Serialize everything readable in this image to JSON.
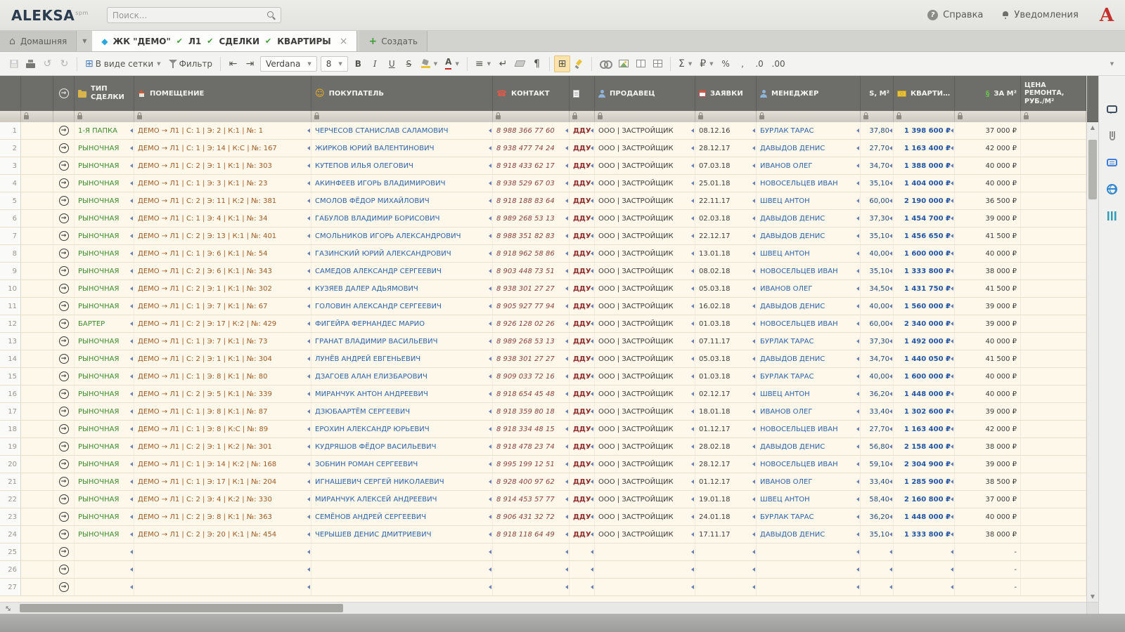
{
  "colors": {
    "accent_green": "#3f9c35",
    "type_green": "#3f8a2e",
    "room_brown": "#9e5a24",
    "link_blue": "#2f62a8",
    "price_blue": "#2456a4",
    "contact_red": "#8a4040",
    "brand_red": "#c4302b",
    "header_gray": "#6d6d69",
    "row_cream": "#fdf8ea"
  },
  "topbar": {
    "logo": "ALEKSA",
    "logo_sup": "spm",
    "search_placeholder": "Поиск...",
    "help": "Справка",
    "notifications": "Уведомления",
    "brand_letter": "A"
  },
  "tabs": {
    "home": "Домашняя",
    "active_parts": [
      "ЖК \"ДЕМО\"",
      "Л1",
      "СДЕЛКИ",
      "КВАРТИРЫ"
    ],
    "create": "Создать"
  },
  "toolbar": {
    "view_mode": "В виде сетки",
    "filter": "Фильтр",
    "font": "Verdana",
    "size": "8",
    "bold": "B",
    "italic": "I",
    "underline": "U",
    "strike": "S",
    "text_color": "А",
    "sum": "Σ",
    "ruble": "₽",
    "percent": "%",
    "comma": ",",
    "dec0": ".0",
    "dec00": ".00"
  },
  "right_rail": {
    "icons": [
      "comments-icon",
      "attachment-icon",
      "notes-icon",
      "web-icon",
      "analytics-icon"
    ]
  },
  "grid": {
    "columns": [
      {
        "key": "rownum",
        "label": ""
      },
      {
        "key": "spacer",
        "label": ""
      },
      {
        "key": "arrow",
        "label": "",
        "icon": "arrow-circle-icon"
      },
      {
        "key": "type",
        "label": "ТИП СДЕЛКИ",
        "icon": "folder-icon"
      },
      {
        "key": "room",
        "label": "ПОМЕЩЕНИЕ",
        "icon": "house-icon"
      },
      {
        "key": "buyer",
        "label": "ПОКУПАТЕЛЬ",
        "icon": "smiley-icon"
      },
      {
        "key": "contact",
        "label": "КОНТАКТ",
        "icon": "phone-icon"
      },
      {
        "key": "doc",
        "label": "",
        "icon": "document-icon"
      },
      {
        "key": "seller",
        "label": "ПРОДАВЕЦ",
        "icon": "person-icon"
      },
      {
        "key": "date",
        "label": "ЗАЯВКИ",
        "icon": "calendar-icon"
      },
      {
        "key": "manager",
        "label": "МЕНЕДЖЕР",
        "icon": "person-icon"
      },
      {
        "key": "s",
        "label": "S, М²"
      },
      {
        "key": "price",
        "label": "КВАРТИРЫ",
        "icon": "banknote-icon"
      },
      {
        "key": "price_m2",
        "label": "ЗА М²",
        "icon": "section-icon"
      },
      {
        "key": "repair",
        "label": "ЦЕНА РЕМОНТА, РУБ./М²"
      }
    ],
    "rows": [
      {
        "num": 1,
        "type": "1-Я ПАПКА",
        "room": "ДЕМО → Л1 | С: 1 | Э: 2 | К:1 | №: 1",
        "buyer": "ЧЕРЧЕСОВ СТАНИСЛАВ САЛАМОВИЧ",
        "contact": "8 988 366 77 60",
        "doc": "ДДУ",
        "seller": "ООО | ЗАСТРОЙЩИК",
        "date": "08.12.16",
        "manager": "БУРЛАК ТАРАС",
        "s": "37,80",
        "price": "1 398 600 ₽",
        "price_m2": "37 000 ₽",
        "repair": ""
      },
      {
        "num": 2,
        "type": "РЫНОЧНАЯ",
        "room": "ДЕМО → Л1 | С: 1 | Э: 14 | К:С | №: 167",
        "buyer": "ЖИРКОВ ЮРИЙ ВАЛЕНТИНОВИЧ",
        "contact": "8 938 477 74 24",
        "doc": "ДДУ",
        "seller": "ООО | ЗАСТРОЙЩИК",
        "date": "28.12.17",
        "manager": "ДАВЫДОВ ДЕНИС",
        "s": "27,70",
        "price": "1 163 400 ₽",
        "price_m2": "42 000 ₽",
        "repair": ""
      },
      {
        "num": 3,
        "type": "РЫНОЧНАЯ",
        "room": "ДЕМО → Л1 | С: 2 | Э: 1 | К:1 | №: 303",
        "buyer": "КУТЕПОВ ИЛЬЯ ОЛЕГОВИЧ",
        "contact": "8 918 433 62 17",
        "doc": "ДДУ",
        "seller": "ООО | ЗАСТРОЙЩИК",
        "date": "07.03.18",
        "manager": "ИВАНОВ ОЛЕГ",
        "s": "34,70",
        "price": "1 388 000 ₽",
        "price_m2": "40 000 ₽",
        "repair": ""
      },
      {
        "num": 4,
        "type": "РЫНОЧНАЯ",
        "room": "ДЕМО → Л1 | С: 1 | Э: 3 | К:1 | №: 23",
        "buyer": "АКИНФЕЕВ ИГОРЬ ВЛАДИМИРОВИЧ",
        "contact": "8 938 529 67 03",
        "doc": "ДДУ",
        "seller": "ООО | ЗАСТРОЙЩИК",
        "date": "25.01.18",
        "manager": "НОВОСЕЛЬЦЕВ ИВАН",
        "s": "35,10",
        "price": "1 404 000 ₽",
        "price_m2": "40 000 ₽",
        "repair": ""
      },
      {
        "num": 5,
        "type": "РЫНОЧНАЯ",
        "room": "ДЕМО → Л1 | С: 2 | Э: 11 | К:2 | №: 381",
        "buyer": "СМОЛОВ ФЁДОР МИХАЙЛОВИЧ",
        "contact": "8 918 188 83 64",
        "doc": "ДДУ",
        "seller": "ООО | ЗАСТРОЙЩИК",
        "date": "22.11.17",
        "manager": "ШВЕЦ АНТОН",
        "s": "60,00",
        "price": "2 190 000 ₽",
        "price_m2": "36 500 ₽",
        "repair": ""
      },
      {
        "num": 6,
        "type": "РЫНОЧНАЯ",
        "room": "ДЕМО → Л1 | С: 1 | Э: 4 | К:1 | №: 34",
        "buyer": "ГАБУЛОВ ВЛАДИМИР БОРИСОВИЧ",
        "contact": "8 989 268 53 13",
        "doc": "ДДУ",
        "seller": "ООО | ЗАСТРОЙЩИК",
        "date": "02.03.18",
        "manager": "ДАВЫДОВ ДЕНИС",
        "s": "37,30",
        "price": "1 454 700 ₽",
        "price_m2": "39 000 ₽",
        "repair": ""
      },
      {
        "num": 7,
        "type": "РЫНОЧНАЯ",
        "room": "ДЕМО → Л1 | С: 2 | Э: 13 | К:1 | №: 401",
        "buyer": "СМОЛЬНИКОВ ИГОРЬ АЛЕКСАНДРОВИЧ",
        "contact": "8 988 351 82 83",
        "doc": "ДДУ",
        "seller": "ООО | ЗАСТРОЙЩИК",
        "date": "22.12.17",
        "manager": "ДАВЫДОВ ДЕНИС",
        "s": "35,10",
        "price": "1 456 650 ₽",
        "price_m2": "41 500 ₽",
        "repair": ""
      },
      {
        "num": 8,
        "type": "РЫНОЧНАЯ",
        "room": "ДЕМО → Л1 | С: 1 | Э: 6 | К:1 | №: 54",
        "buyer": "ГАЗИНСКИЙ ЮРИЙ АЛЕКСАНДРОВИЧ",
        "contact": "8 918 962 58 86",
        "doc": "ДДУ",
        "seller": "ООО | ЗАСТРОЙЩИК",
        "date": "13.01.18",
        "manager": "ШВЕЦ АНТОН",
        "s": "40,00",
        "price": "1 600 000 ₽",
        "price_m2": "40 000 ₽",
        "repair": ""
      },
      {
        "num": 9,
        "type": "РЫНОЧНАЯ",
        "room": "ДЕМО → Л1 | С: 2 | Э: 6 | К:1 | №: 343",
        "buyer": "САМЕДОВ АЛЕКСАНДР СЕРГЕЕВИЧ",
        "contact": "8 903 448 73 51",
        "doc": "ДДУ",
        "seller": "ООО | ЗАСТРОЙЩИК",
        "date": "08.02.18",
        "manager": "НОВОСЕЛЬЦЕВ ИВАН",
        "s": "35,10",
        "price": "1 333 800 ₽",
        "price_m2": "38 000 ₽",
        "repair": ""
      },
      {
        "num": 10,
        "type": "РЫНОЧНАЯ",
        "room": "ДЕМО → Л1 | С: 2 | Э: 1 | К:1 | №: 302",
        "buyer": "КУЗЯЕВ ДАЛЕР АДЬЯМОВИЧ",
        "contact": "8 938 301 27 27",
        "doc": "ДДУ",
        "seller": "ООО | ЗАСТРОЙЩИК",
        "date": "05.03.18",
        "manager": "ИВАНОВ ОЛЕГ",
        "s": "34,50",
        "price": "1 431 750 ₽",
        "price_m2": "41 500 ₽",
        "repair": ""
      },
      {
        "num": 11,
        "type": "РЫНОЧНАЯ",
        "room": "ДЕМО → Л1 | С: 1 | Э: 7 | К:1 | №: 67",
        "buyer": "ГОЛОВИН АЛЕКСАНДР СЕРГЕЕВИЧ",
        "contact": "8 905 927 77 94",
        "doc": "ДДУ",
        "seller": "ООО | ЗАСТРОЙЩИК",
        "date": "16.02.18",
        "manager": "ДАВЫДОВ ДЕНИС",
        "s": "40,00",
        "price": "1 560 000 ₽",
        "price_m2": "39 000 ₽",
        "repair": ""
      },
      {
        "num": 12,
        "type": "БАРТЕР",
        "room": "ДЕМО → Л1 | С: 2 | Э: 17 | К:2 | №: 429",
        "buyer": "ФИГЕЙРА ФЕРНАНДЕС МАРИО",
        "contact": "8 926 128 02 26",
        "doc": "ДДУ",
        "seller": "ООО | ЗАСТРОЙЩИК",
        "date": "01.03.18",
        "manager": "НОВОСЕЛЬЦЕВ ИВАН",
        "s": "60,00",
        "price": "2 340 000 ₽",
        "price_m2": "39 000 ₽",
        "repair": ""
      },
      {
        "num": 13,
        "type": "РЫНОЧНАЯ",
        "room": "ДЕМО → Л1 | С: 1 | Э: 7 | К:1 | №: 73",
        "buyer": "ГРАНАТ ВЛАДИМИР ВАСИЛЬЕВИЧ",
        "contact": "8 989 268 53 13",
        "doc": "ДДУ",
        "seller": "ООО | ЗАСТРОЙЩИК",
        "date": "07.11.17",
        "manager": "БУРЛАК ТАРАС",
        "s": "37,30",
        "price": "1 492 000 ₽",
        "price_m2": "40 000 ₽",
        "repair": ""
      },
      {
        "num": 14,
        "type": "РЫНОЧНАЯ",
        "room": "ДЕМО → Л1 | С: 2 | Э: 1 | К:1 | №: 304",
        "buyer": "ЛУНЁВ АНДРЕЙ ЕВГЕНЬЕВИЧ",
        "contact": "8 938 301 27 27",
        "doc": "ДДУ",
        "seller": "ООО | ЗАСТРОЙЩИК",
        "date": "05.03.18",
        "manager": "ДАВЫДОВ ДЕНИС",
        "s": "34,70",
        "price": "1 440 050 ₽",
        "price_m2": "41 500 ₽",
        "repair": ""
      },
      {
        "num": 15,
        "type": "РЫНОЧНАЯ",
        "room": "ДЕМО → Л1 | С: 1 | Э: 8 | К:1 | №: 80",
        "buyer": "ДЗАГОЕВ АЛАН ЕЛИЗБАРОВИЧ",
        "contact": "8 909 033 72 16",
        "doc": "ДДУ",
        "seller": "ООО | ЗАСТРОЙЩИК",
        "date": "01.03.18",
        "manager": "БУРЛАК ТАРАС",
        "s": "40,00",
        "price": "1 600 000 ₽",
        "price_m2": "40 000 ₽",
        "repair": ""
      },
      {
        "num": 16,
        "type": "РЫНОЧНАЯ",
        "room": "ДЕМО → Л1 | С: 2 | Э: 5 | К:1 | №: 339",
        "buyer": "МИРАНЧУК АНТОН АНДРЕЕВИЧ",
        "contact": "8 918 654 45 48",
        "doc": "ДДУ",
        "seller": "ООО | ЗАСТРОЙЩИК",
        "date": "02.12.17",
        "manager": "ШВЕЦ АНТОН",
        "s": "36,20",
        "price": "1 448 000 ₽",
        "price_m2": "40 000 ₽",
        "repair": ""
      },
      {
        "num": 17,
        "type": "РЫНОЧНАЯ",
        "room": "ДЕМО → Л1 | С: 1 | Э: 8 | К:1 | №: 87",
        "buyer": "ДЗЮБААРТЁМ СЕРГЕЕВИЧ",
        "contact": "8 918 359 80 18",
        "doc": "ДДУ",
        "seller": "ООО | ЗАСТРОЙЩИК",
        "date": "18.01.18",
        "manager": "ИВАНОВ ОЛЕГ",
        "s": "33,40",
        "price": "1 302 600 ₽",
        "price_m2": "39 000 ₽",
        "repair": ""
      },
      {
        "num": 18,
        "type": "РЫНОЧНАЯ",
        "room": "ДЕМО → Л1 | С: 1 | Э: 8 | К:С | №: 89",
        "buyer": "ЕРОХИН АЛЕКСАНДР ЮРЬЕВИЧ",
        "contact": "8 918 334 48 15",
        "doc": "ДДУ",
        "seller": "ООО | ЗАСТРОЙЩИК",
        "date": "01.12.17",
        "manager": "НОВОСЕЛЬЦЕВ ИВАН",
        "s": "27,70",
        "price": "1 163 400 ₽",
        "price_m2": "42 000 ₽",
        "repair": ""
      },
      {
        "num": 19,
        "type": "РЫНОЧНАЯ",
        "room": "ДЕМО → Л1 | С: 2 | Э: 1 | К:2 | №: 301",
        "buyer": "КУДРЯШОВ ФЁДОР ВАСИЛЬЕВИЧ",
        "contact": "8 918 478 23 74",
        "doc": "ДДУ",
        "seller": "ООО | ЗАСТРОЙЩИК",
        "date": "28.02.18",
        "manager": "ДАВЫДОВ ДЕНИС",
        "s": "56,80",
        "price": "2 158 400 ₽",
        "price_m2": "38 000 ₽",
        "repair": ""
      },
      {
        "num": 20,
        "type": "РЫНОЧНАЯ",
        "room": "ДЕМО → Л1 | С: 1 | Э: 14 | К:2 | №: 168",
        "buyer": "ЗОБНИН РОМАН СЕРГЕЕВИЧ",
        "contact": "8 995 199 12 51",
        "doc": "ДДУ",
        "seller": "ООО | ЗАСТРОЙЩИК",
        "date": "28.12.17",
        "manager": "НОВОСЕЛЬЦЕВ ИВАН",
        "s": "59,10",
        "price": "2 304 900 ₽",
        "price_m2": "39 000 ₽",
        "repair": ""
      },
      {
        "num": 21,
        "type": "РЫНОЧНАЯ",
        "room": "ДЕМО → Л1 | С: 1 | Э: 17 | К:1 | №: 204",
        "buyer": "ИГНАШЕВИЧ СЕРГЕЙ НИКОЛАЕВИЧ",
        "contact": "8 928 400 97 62",
        "doc": "ДДУ",
        "seller": "ООО | ЗАСТРОЙЩИК",
        "date": "01.12.17",
        "manager": "ИВАНОВ ОЛЕГ",
        "s": "33,40",
        "price": "1 285 900 ₽",
        "price_m2": "38 500 ₽",
        "repair": ""
      },
      {
        "num": 22,
        "type": "РЫНОЧНАЯ",
        "room": "ДЕМО → Л1 | С: 2 | Э: 4 | К:2 | №: 330",
        "buyer": "МИРАНЧУК АЛЕКСЕЙ АНДРЕЕВИЧ",
        "contact": "8 914 453 57 77",
        "doc": "ДДУ",
        "seller": "ООО | ЗАСТРОЙЩИК",
        "date": "19.01.18",
        "manager": "ШВЕЦ АНТОН",
        "s": "58,40",
        "price": "2 160 800 ₽",
        "price_m2": "37 000 ₽",
        "repair": ""
      },
      {
        "num": 23,
        "type": "РЫНОЧНАЯ",
        "room": "ДЕМО → Л1 | С: 2 | Э: 8 | К:1 | №: 363",
        "buyer": "СЕМЁНОВ АНДРЕЙ СЕРГЕЕВИЧ",
        "contact": "8 906 431 32 72",
        "doc": "ДДУ",
        "seller": "ООО | ЗАСТРОЙЩИК",
        "date": "24.01.18",
        "manager": "БУРЛАК ТАРАС",
        "s": "36,20",
        "price": "1 448 000 ₽",
        "price_m2": "40 000 ₽",
        "repair": ""
      },
      {
        "num": 24,
        "type": "РЫНОЧНАЯ",
        "room": "ДЕМО → Л1 | С: 2 | Э: 20 | К:1 | №: 454",
        "buyer": "ЧЕРЫШЕВ ДЕНИС ДМИТРИЕВИЧ",
        "contact": "8 918 118 64 49",
        "doc": "ДДУ",
        "seller": "ООО | ЗАСТРОЙЩИК",
        "date": "17.11.17",
        "manager": "ДАВЫДОВ ДЕНИС",
        "s": "35,10",
        "price": "1 333 800 ₽",
        "price_m2": "38 000 ₽",
        "repair": ""
      },
      {
        "num": 25,
        "type": "",
        "room": "",
        "buyer": "",
        "contact": "",
        "doc": "",
        "seller": "",
        "date": "",
        "manager": "",
        "s": "",
        "price": "",
        "price_m2": "-",
        "repair": ""
      },
      {
        "num": 26,
        "type": "",
        "room": "",
        "buyer": "",
        "contact": "",
        "doc": "",
        "seller": "",
        "date": "",
        "manager": "",
        "s": "",
        "price": "",
        "price_m2": "-",
        "repair": ""
      },
      {
        "num": 27,
        "type": "",
        "room": "",
        "buyer": "",
        "contact": "",
        "doc": "",
        "seller": "",
        "date": "",
        "manager": "",
        "s": "",
        "price": "",
        "price_m2": "-",
        "repair": ""
      }
    ]
  }
}
